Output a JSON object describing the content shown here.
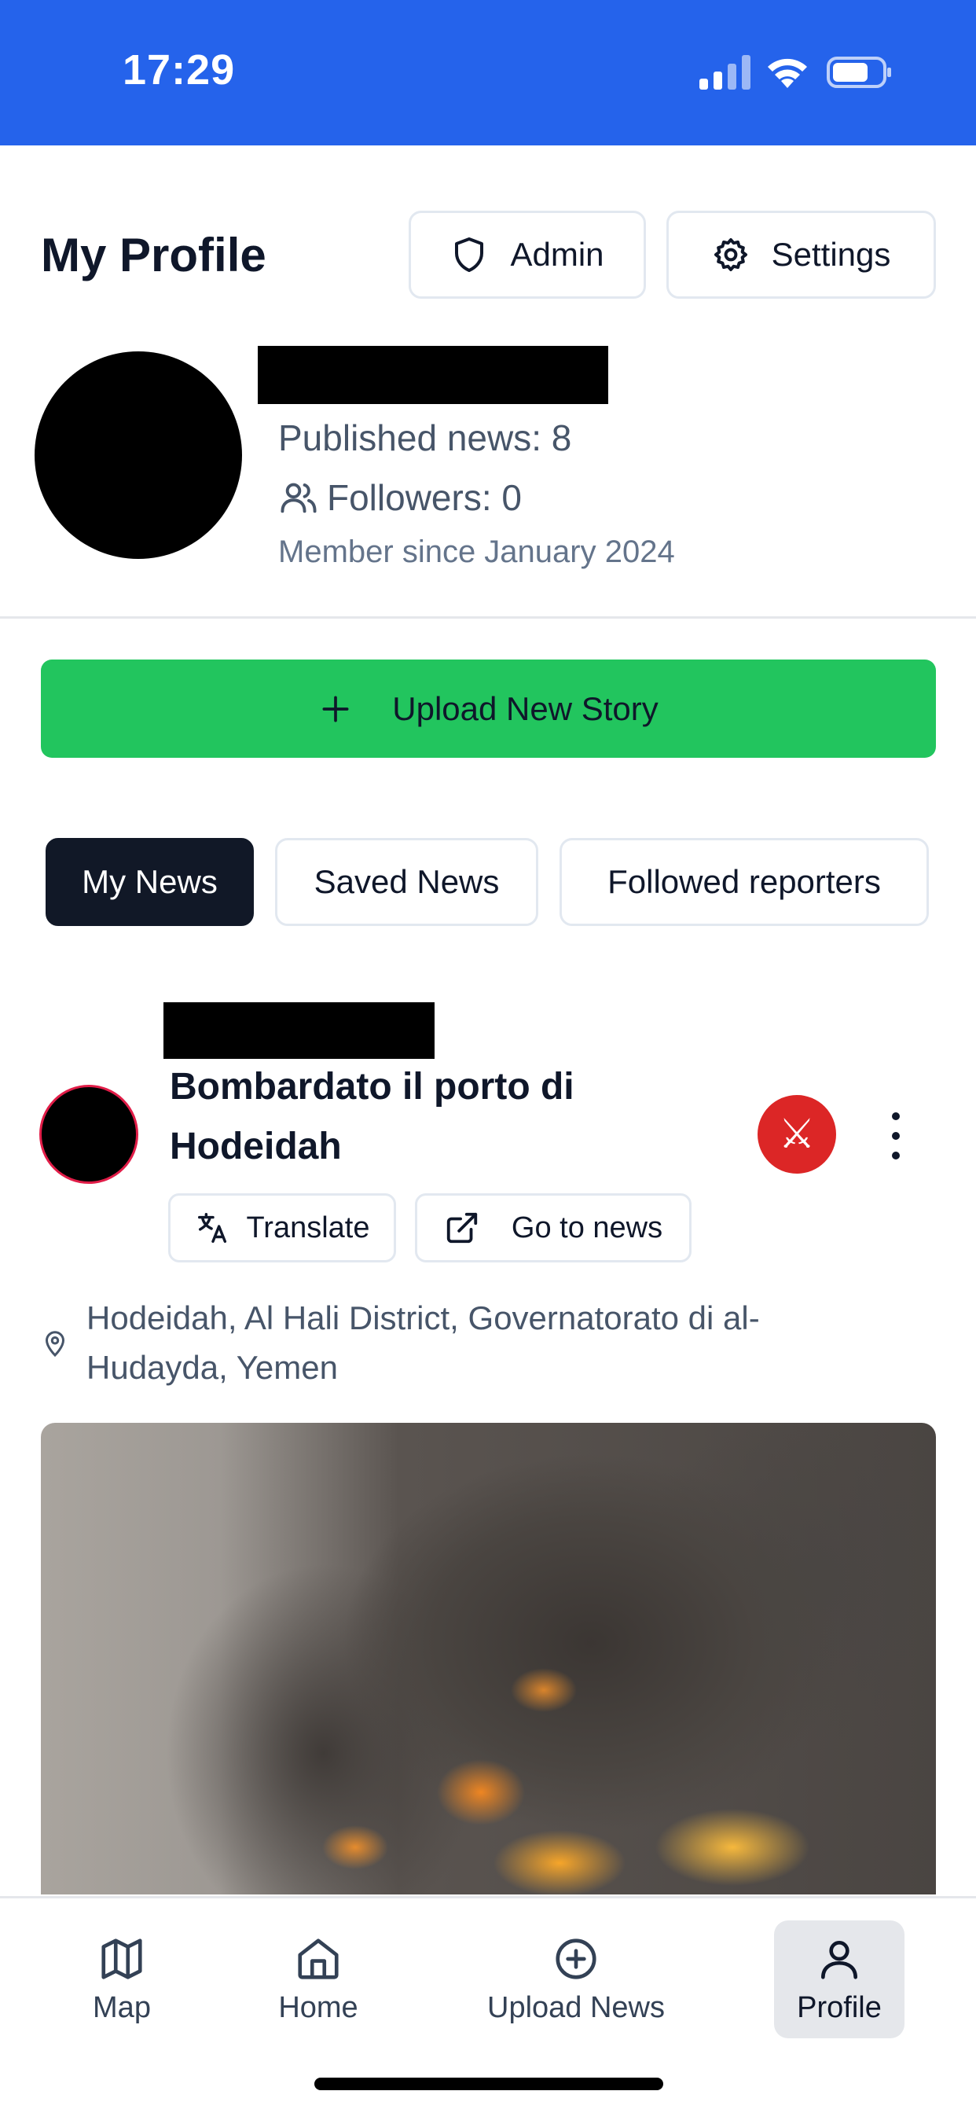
{
  "status_bar": {
    "time": "17:29",
    "icons": [
      "signal-icon",
      "wifi-icon",
      "battery-icon"
    ],
    "background_color": "#2563eb"
  },
  "header": {
    "title": "My Profile",
    "admin_label": "Admin",
    "settings_label": "Settings"
  },
  "profile": {
    "published_news": "Published news: 8",
    "followers": "Followers: 0",
    "member_since": "Member since January 2024"
  },
  "upload": {
    "label": "Upload New Story",
    "color": "#22c55e"
  },
  "tabs": [
    {
      "label": "My News",
      "active": true
    },
    {
      "label": "Saved News",
      "active": false
    },
    {
      "label": "Followed reporters",
      "active": false
    }
  ],
  "post": {
    "title": "Bombardato il porto di Hodeidah",
    "category_icon": "crossed-swords-icon",
    "category_glyph": "⚔",
    "translate_label": "Translate",
    "go_to_news_label": "Go to news",
    "location": "Hodeidah, Al Hali District, Governatorato di al-Hudayda, Yemen"
  },
  "bottom_nav": [
    {
      "label": "Map",
      "icon": "map-icon"
    },
    {
      "label": "Home",
      "icon": "home-icon"
    },
    {
      "label": "Upload News",
      "icon": "plus-circle-icon"
    },
    {
      "label": "Profile",
      "icon": "user-icon",
      "active": true
    }
  ]
}
